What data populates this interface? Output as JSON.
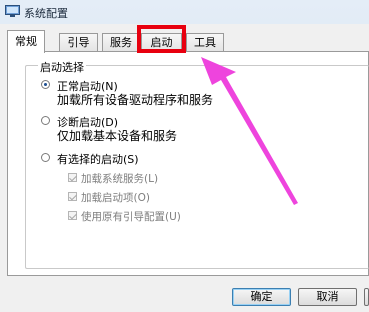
{
  "window": {
    "title": "系统配置"
  },
  "tabs": [
    {
      "label": "常规",
      "active": true
    },
    {
      "label": "引导",
      "active": false
    },
    {
      "label": "服务",
      "active": false
    },
    {
      "label": "启动",
      "active": false
    },
    {
      "label": "工具",
      "active": false
    }
  ],
  "startup": {
    "group_label": "启动选择",
    "normal": {
      "label": "正常启动(N)",
      "desc": "加载所有设备驱动程序和服务",
      "selected": true
    },
    "diagnostic": {
      "label": "诊断启动(D)",
      "desc": "仅加载基本设备和服务",
      "selected": false
    },
    "selective": {
      "label": "有选择的启动(S)",
      "selected": false,
      "options": [
        {
          "label": "加载系统服务(L)",
          "checked": true
        },
        {
          "label": "加载启动项(O)",
          "checked": true
        },
        {
          "label": "使用原有引导配置(U)",
          "checked": true
        }
      ]
    }
  },
  "buttons": {
    "ok": "确定",
    "cancel": "取消"
  },
  "annotation": {
    "highlight_color": "#e8000f",
    "arrow_color": "#ee44dd"
  }
}
